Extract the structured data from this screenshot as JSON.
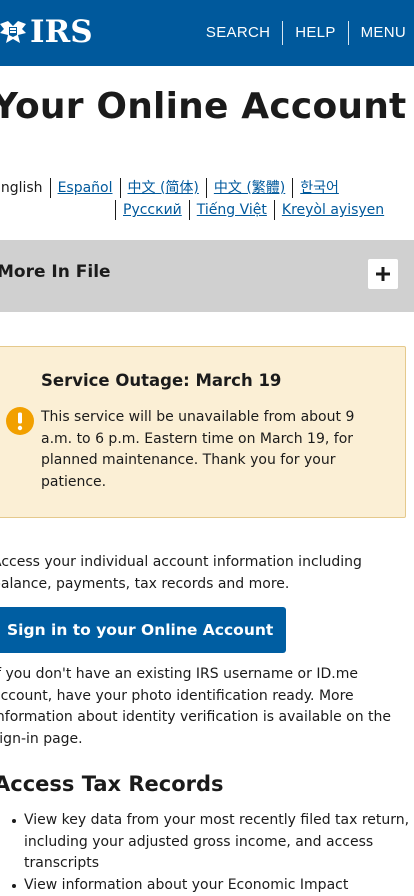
{
  "header": {
    "logo_text": "IRS",
    "nav": [
      "SEARCH",
      "HELP",
      "MENU"
    ]
  },
  "page_title": "Your Online Account",
  "languages": {
    "current": "English",
    "row1": [
      "Español",
      "中文 (简体)",
      "中文 (繁體)",
      "한국어"
    ],
    "row2": [
      "Русский",
      "Tiếng Việt",
      "Kreyòl ayisyen"
    ]
  },
  "more_in_file": {
    "label": "More In File",
    "toggle_icon": "plus-icon"
  },
  "alert": {
    "title": "Service Outage: March 19",
    "body": "This service will be unavailable from about 9 a.m. to 6 p.m. Eastern time on March 19, for planned maintenance. Thank you for your patience.",
    "icon": "exclamation-circle-icon",
    "icon_color": "#f2a000"
  },
  "intro": "Access your individual account information including balance, payments, tax records and more.",
  "signin_button": "Sign in to your Online Account",
  "help_text": "If you don't have an existing IRS username or ID.me account, have your photo identification ready. More information about identity verification is available on the sign-in page.",
  "tax_records": {
    "heading": "Access Tax Records",
    "items": [
      "View key data from your most recently filed tax return, including your adjusted gross income, and access transcripts",
      "View information about your Economic Impact"
    ]
  },
  "colors": {
    "brand": "#00599c",
    "button": "#005ea2",
    "link": "#00599c",
    "alert_bg": "#fbefd5",
    "bar_bg": "#d0d0d0"
  }
}
